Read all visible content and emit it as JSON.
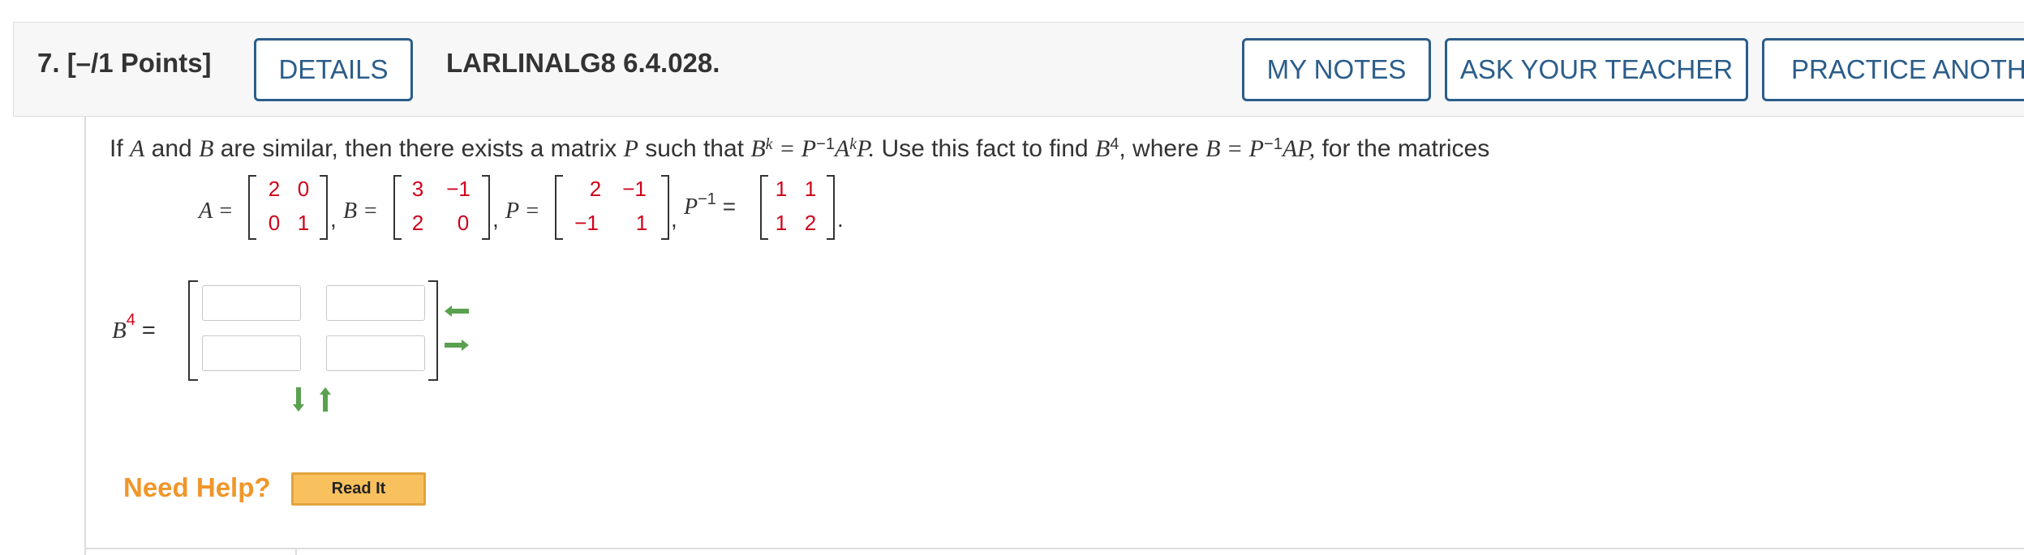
{
  "header": {
    "question_number": "7.  [–/1 Points]",
    "details_label": "DETAILS",
    "problem_code": "LARLINALG8 6.4.028.",
    "my_notes_label": "MY NOTES",
    "ask_teacher_label": "ASK YOUR TEACHER",
    "practice_label": "PRACTICE ANOTHER"
  },
  "question": {
    "part1": "If ",
    "A": "A",
    "and": " and ",
    "B": "B",
    "part2": " are similar, then there exists a matrix ",
    "P": "P",
    "part3": " such that  ",
    "eq1": "B",
    "eq1_sup": "k",
    "eq1_mid": " = P",
    "eq1_sup2": "−1",
    "eq1_A": "A",
    "eq1_sup3": "k",
    "eq1_end": "P.",
    "part4": "  Use this fact to find ",
    "B4": "B",
    "B4_sup": "4",
    "part5": ", where  ",
    "eq2": "B = P",
    "eq2_sup": "−1",
    "eq2_end": "AP,",
    "part6": "  for the matrices"
  },
  "matrices": {
    "A_label": "A =",
    "A": [
      "2",
      "0",
      "0",
      "1"
    ],
    "B_label": "B =",
    "B": [
      "3",
      "−1",
      "2",
      "0"
    ],
    "P_label": "P =",
    "P": [
      "2",
      "−1",
      "−1",
      "1"
    ],
    "Pinv_label": "P",
    "Pinv_sup": "−1",
    "Pinv_eq": " =",
    "Pinv": [
      "1",
      "1",
      "1",
      "2"
    ],
    "comma": ",",
    "period": "."
  },
  "answer": {
    "label": "B",
    "label_sup": "4",
    "label_eq": " =",
    "cells": [
      "",
      "",
      "",
      ""
    ]
  },
  "help": {
    "need_help": "Need Help?",
    "read_it": "Read It"
  },
  "colors": {
    "accent": "#2b5d8a",
    "matrix_value": "#d0021b",
    "arrow": "#5aa14f",
    "help": "#f0962a",
    "read_it_bg": "#f9c15d"
  },
  "icons": {
    "arrow_left": "arrow-left-icon",
    "arrow_right": "arrow-right-icon",
    "arrow_down": "arrow-down-icon",
    "arrow_up": "arrow-up-icon"
  }
}
